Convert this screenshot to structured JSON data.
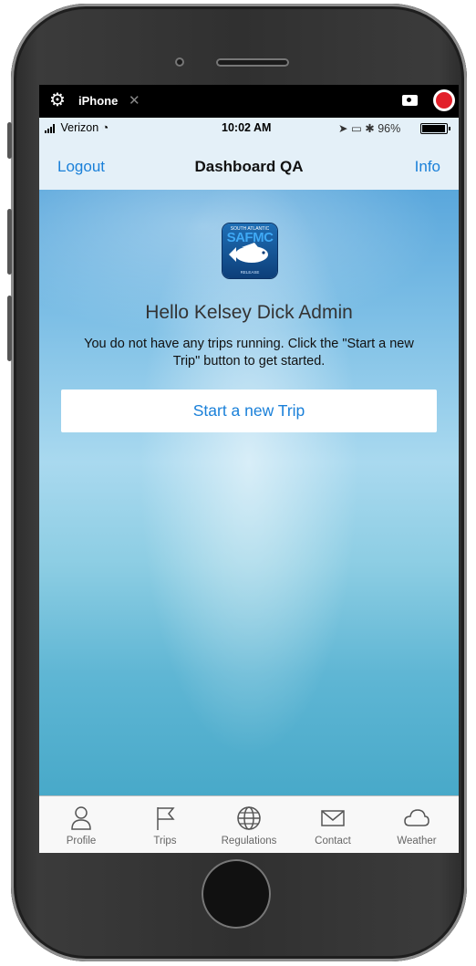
{
  "simulator": {
    "title": "iPhone",
    "close_glyph": "✕",
    "settings_icon": "gear-icon",
    "camera_icon": "camera-icon",
    "record_icon": "record-icon",
    "record_color": "#e2202a"
  },
  "status_bar": {
    "carrier": "Verizon",
    "time": "10:02 AM",
    "battery": "96%"
  },
  "nav": {
    "left": "Logout",
    "title": "Dashboard QA",
    "right": "Info",
    "accent": "#1a80d9"
  },
  "content": {
    "logo": {
      "top_text": "SOUTH ATLANTIC",
      "word": "SAFMC",
      "bottom_text": "RELEASE"
    },
    "greeting": "Hello Kelsey Dick Admin",
    "message": "You do not have any trips running. Click the \"Start a new Trip\" button to get started.",
    "start_button": "Start a new Trip"
  },
  "tabs": [
    {
      "label": "Profile",
      "icon": "person-icon"
    },
    {
      "label": "Trips",
      "icon": "flag-icon"
    },
    {
      "label": "Regulations",
      "icon": "globe-icon"
    },
    {
      "label": "Contact",
      "icon": "envelope-icon"
    },
    {
      "label": "Weather",
      "icon": "cloud-icon"
    }
  ]
}
